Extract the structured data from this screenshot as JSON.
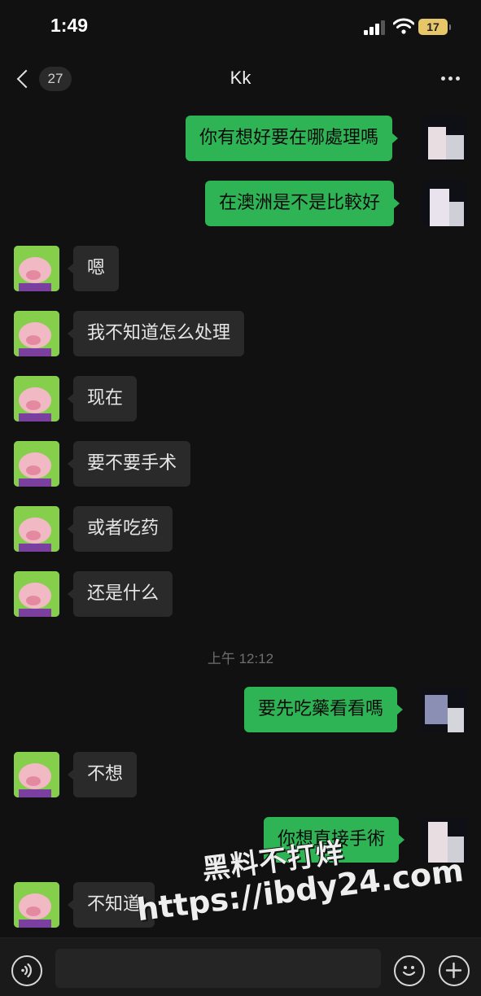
{
  "status_bar": {
    "time": "1:49",
    "battery": "17",
    "signal_icon": "cellular-signal-icon",
    "wifi_icon": "wifi-icon"
  },
  "nav": {
    "back_icon": "chevron-left-icon",
    "unread_count": "27",
    "title": "Kk",
    "more_icon": "ellipsis-icon"
  },
  "messages": [
    {
      "side": "out",
      "text": "你有想好要在哪處理嗎"
    },
    {
      "side": "out",
      "text": "在澳洲是不是比較好"
    },
    {
      "side": "in",
      "text": "嗯"
    },
    {
      "side": "in",
      "text": "我不知道怎么处理"
    },
    {
      "side": "in",
      "text": "现在"
    },
    {
      "side": "in",
      "text": "要不要手术"
    },
    {
      "side": "in",
      "text": "或者吃药"
    },
    {
      "side": "in",
      "text": "还是什么"
    },
    {
      "side": "out",
      "text": "要先吃藥看看嗎"
    },
    {
      "side": "in",
      "text": "不想"
    },
    {
      "side": "out",
      "text": "你想直接手術"
    },
    {
      "side": "in",
      "text": "不知道"
    }
  ],
  "timestamp": "上午 12:12",
  "watermark": {
    "line1": "黑料不打烊",
    "line2": "https://ibdy24.com"
  },
  "input_bar": {
    "voice_icon": "voice-icon",
    "emoji_icon": "emoji-icon",
    "plus_icon": "plus-icon",
    "placeholder": ""
  },
  "colors": {
    "background": "#111111",
    "outgoing_bubble": "#2fb455",
    "incoming_bubble": "#2a2a2a",
    "accent": "#e7c66a"
  }
}
